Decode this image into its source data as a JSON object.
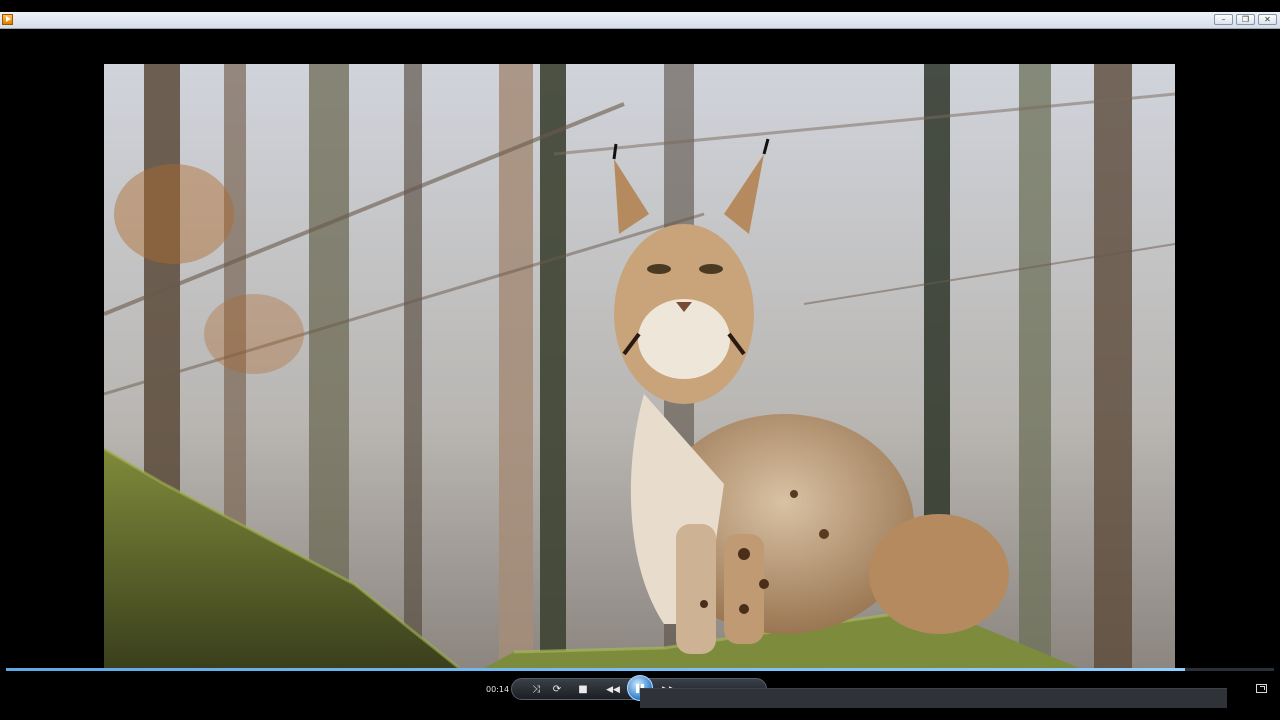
{
  "window": {
    "title": "",
    "minimize_glyph": "–",
    "restore_glyph": "❐",
    "close_glyph": "✕"
  },
  "video": {
    "subject": "lynx"
  },
  "playback": {
    "elapsed": "00:14",
    "progress_fraction": 0.93
  },
  "controls": {
    "shuffle_glyph": "⤨",
    "repeat_glyph": "⟳",
    "stop_glyph": "■",
    "previous_glyph": "◀◀",
    "next_glyph": "▶▶"
  },
  "colors": {
    "accent": "#5fa8e6",
    "background": "#000000"
  }
}
